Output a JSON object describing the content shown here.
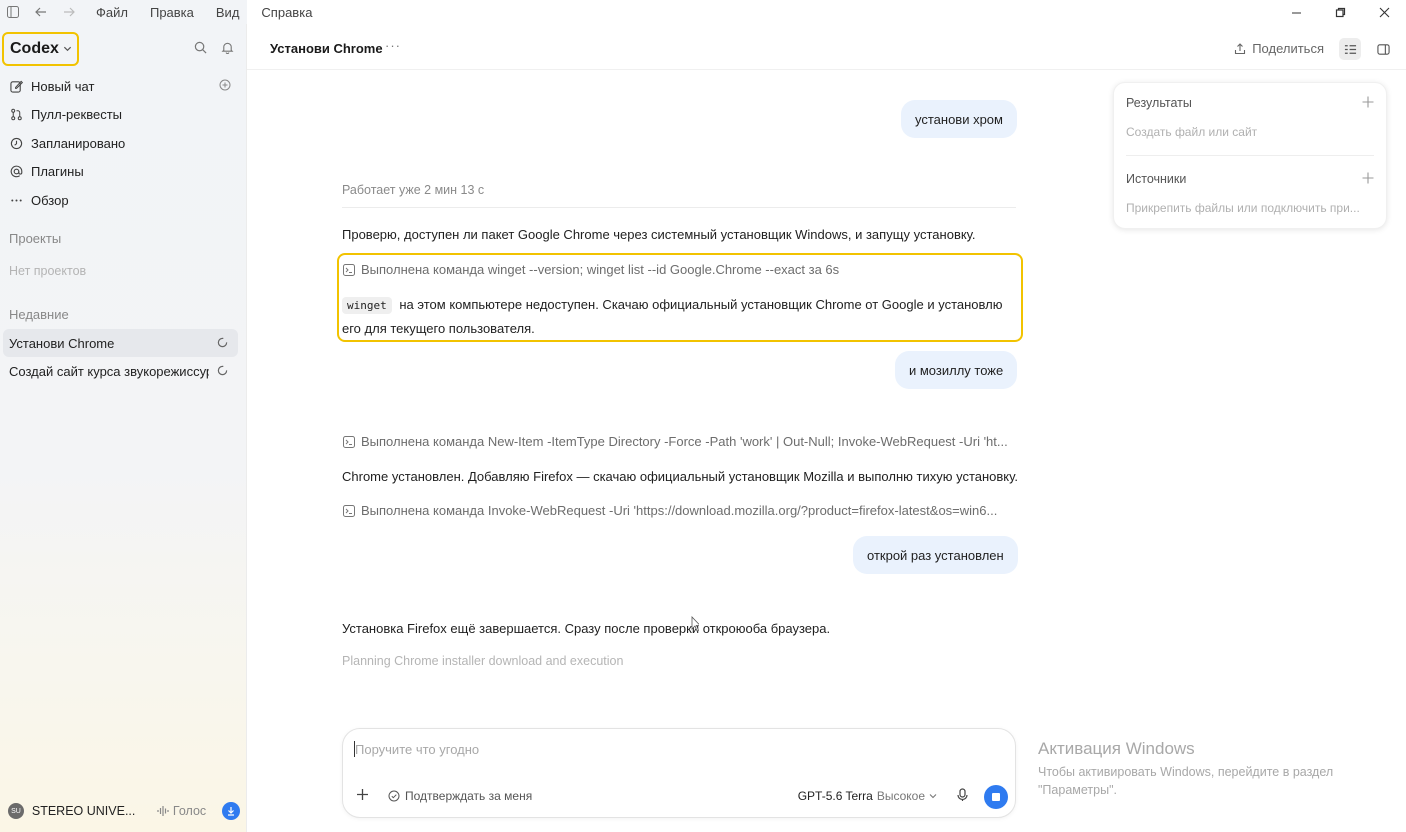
{
  "menubar": {
    "menus": [
      "Файл",
      "Правка",
      "Вид",
      "Справка"
    ]
  },
  "sidebar": {
    "brand": "Codex",
    "nav": [
      {
        "label": "Новый чат",
        "icon": "edit-icon"
      },
      {
        "label": "Пулл-реквесты",
        "icon": "pull-request-icon"
      },
      {
        "label": "Запланировано",
        "icon": "clock-icon"
      },
      {
        "label": "Плагины",
        "icon": "plugin-icon"
      },
      {
        "label": "Обзор",
        "icon": "more-dots-icon"
      }
    ],
    "projects_heading": "Проекты",
    "no_projects": "Нет проектов",
    "recent_heading": "Недавние",
    "recent": [
      {
        "label": "Установи Chrome",
        "active": true
      },
      {
        "label": "Создай сайт курса звукорежиссуры",
        "active": false
      }
    ],
    "account": {
      "initials": "SU",
      "name": "STEREO UNIVE..."
    },
    "voice_label": "Голос"
  },
  "header": {
    "title": "Установи Chrome",
    "more": "···",
    "share_label": "Поделиться"
  },
  "chat": {
    "user_msg_1": "установи хром",
    "working_status": "Работает уже 2 мин 13 с",
    "assistant_1": "Проверю, доступен ли пакет Google Chrome через системный установщик Windows, и запущу установку.",
    "cmd_1": "Выполнена команда winget --version; winget list --id Google.Chrome --exact за 6s",
    "code_word": "winget",
    "assistant_2": "на этом компьютере недоступен. Скачаю официальный установщик Chrome от Google и установлю его для текущего пользователя.",
    "user_msg_2": "и мозиллу тоже",
    "cmd_2": "Выполнена команда New-Item -ItemType Directory -Force -Path 'work' | Out-Null; Invoke-WebRequest -Uri 'ht...",
    "assistant_3": "Chrome установлен. Добавляю Firefox — скачаю официальный установщик Mozilla и выполню тихую установку.",
    "cmd_3": "Выполнена команда Invoke-WebRequest -Uri 'https://download.mozilla.org/?product=firefox-latest&os=win6...",
    "user_msg_3": "открой раз установлен",
    "assistant_4": "Установка Firefox ещё завершается. Сразу после проверки откроюоба браузера.",
    "thinking": "Planning Chrome installer download and execution"
  },
  "right_panel": {
    "results_heading": "Результаты",
    "results_hint": "Создать файл или сайт",
    "sources_heading": "Источники",
    "sources_hint": "Прикрепить файлы или подключить при..."
  },
  "composer": {
    "placeholder": "Поручите что угодно",
    "approve_label": "Подтверждать за меня",
    "model": "GPT-5.6 Terra",
    "level": "Высокое"
  },
  "watermark": {
    "title": "Активация Windows",
    "line1": "Чтобы активировать Windows, перейдите в раздел",
    "line2": "\"Параметры\"."
  },
  "colors": {
    "accent": "#2f7bf0",
    "highlight": "#f2c300",
    "user_bubble": "#eaf2fd"
  }
}
